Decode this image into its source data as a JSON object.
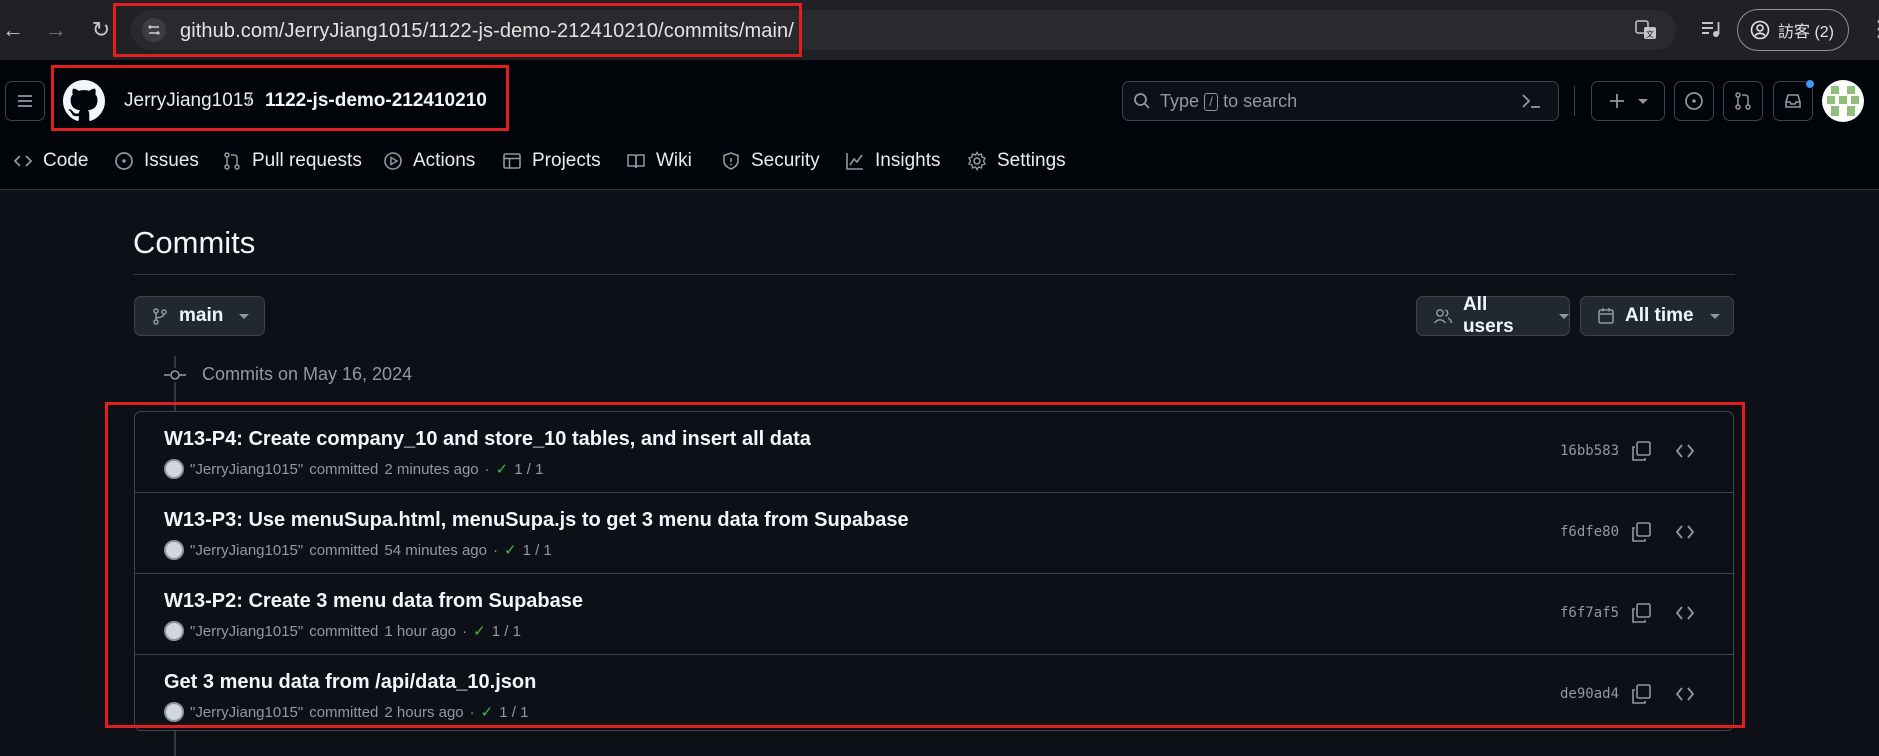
{
  "browser": {
    "url": "github.com/JerryJiang1015/1122-js-demo-212410210/commits/main/",
    "profile_label": "訪客 (2)"
  },
  "repo": {
    "owner": "JerryJiang1015",
    "separator": "/",
    "name": "1122-js-demo-212410210"
  },
  "search": {
    "prefix": "Type",
    "key": "/",
    "suffix": "to search"
  },
  "tabs": [
    {
      "label": "Code",
      "icon": "code-icon"
    },
    {
      "label": "Issues",
      "icon": "issue-icon"
    },
    {
      "label": "Pull requests",
      "icon": "pull-request-icon"
    },
    {
      "label": "Actions",
      "icon": "play-icon"
    },
    {
      "label": "Projects",
      "icon": "table-icon"
    },
    {
      "label": "Wiki",
      "icon": "book-icon"
    },
    {
      "label": "Security",
      "icon": "shield-icon"
    },
    {
      "label": "Insights",
      "icon": "graph-icon"
    },
    {
      "label": "Settings",
      "icon": "gear-icon"
    }
  ],
  "page": {
    "title": "Commits",
    "branch": "main",
    "users_filter": "All users",
    "time_filter": "All time",
    "date_header": "Commits on May 16, 2024"
  },
  "commits": [
    {
      "title": "W13-P4: Create company_10 and store_10 tables, and insert all data",
      "author": "\"JerryJiang1015\"",
      "action": "committed",
      "when": "2 minutes ago",
      "sep": "·",
      "checks": "1 / 1",
      "sha": "16bb583"
    },
    {
      "title": "W13-P3: Use menuSupa.html, menuSupa.js to get 3 menu data from Supabase",
      "author": "\"JerryJiang1015\"",
      "action": "committed",
      "when": "54 minutes ago",
      "sep": "·",
      "checks": "1 / 1",
      "sha": "f6dfe80"
    },
    {
      "title": "W13-P2: Create 3 menu data from Supabase",
      "author": "\"JerryJiang1015\"",
      "action": "committed",
      "when": "1 hour ago",
      "sep": "·",
      "checks": "1 / 1",
      "sha": "f6f7af5"
    },
    {
      "title": "Get 3 menu data from /api/data_10.json",
      "author": "\"JerryJiang1015\"",
      "action": "committed",
      "when": "2 hours ago",
      "sep": "·",
      "checks": "1 / 1",
      "sha": "de90ad4"
    }
  ],
  "colors": {
    "background": "#0d1117",
    "header": "#010409",
    "border": "#3d444d",
    "success": "#3fb950",
    "annotation_red": "#e02020"
  }
}
